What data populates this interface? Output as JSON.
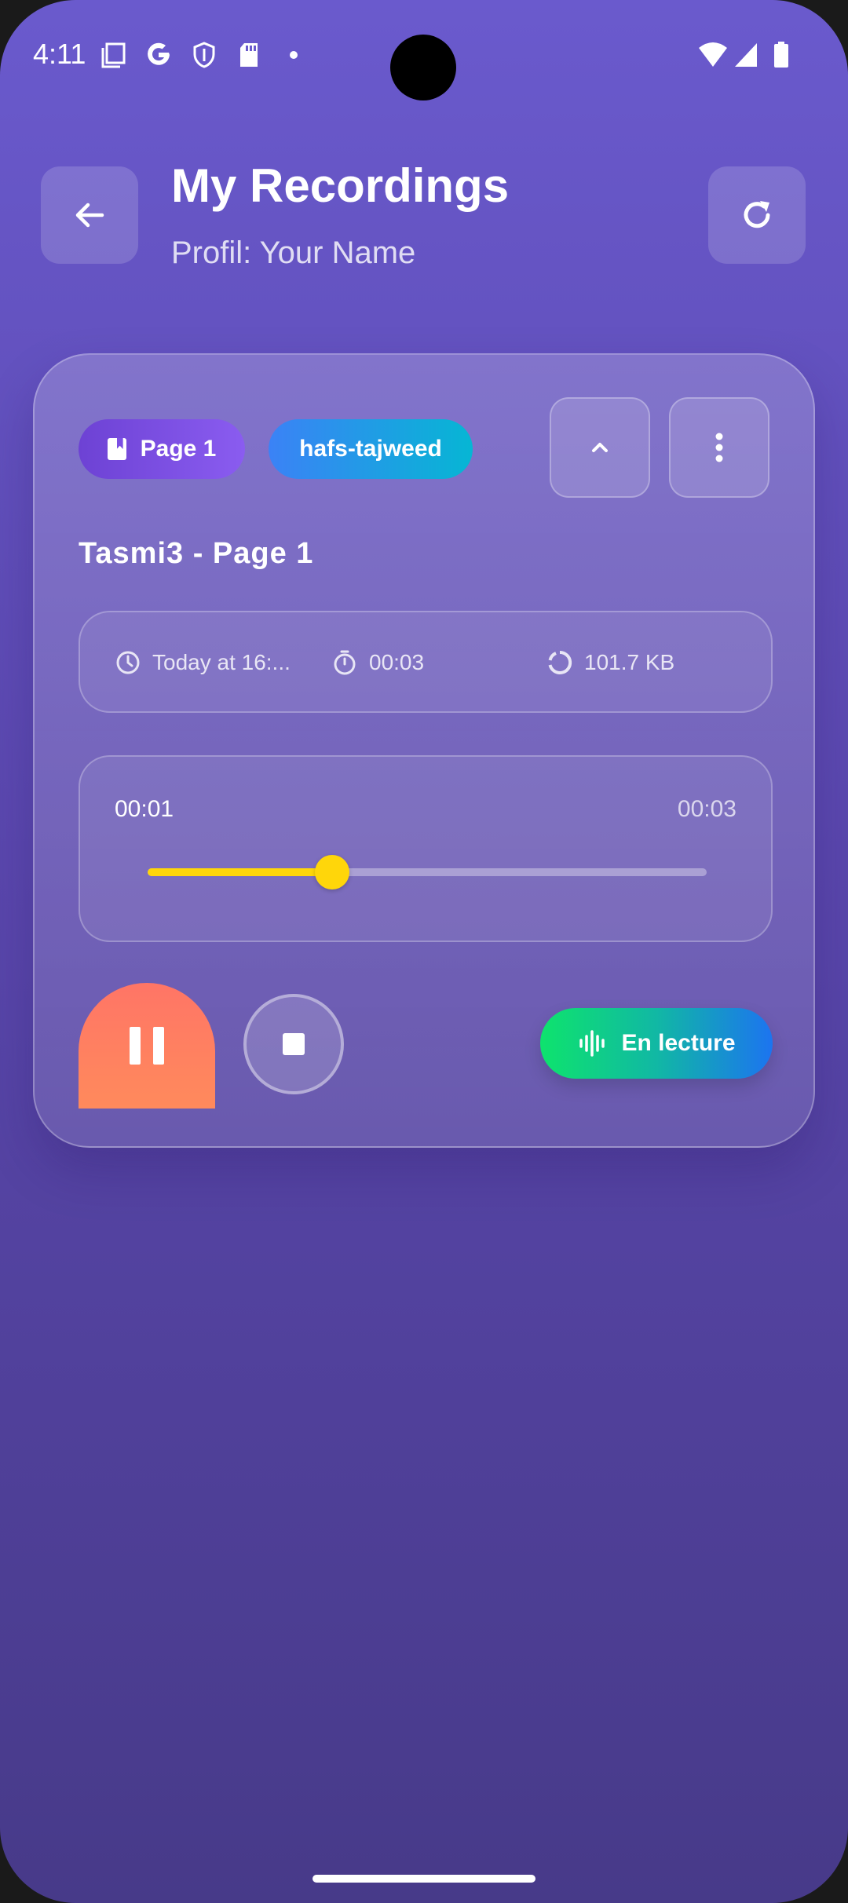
{
  "status_bar": {
    "time": "4:11",
    "left_icons": [
      "screenshot-icon",
      "google-icon",
      "shield-icon",
      "sd-card-icon",
      "dot-icon"
    ],
    "right_icons": [
      "wifi-icon",
      "signal-icon",
      "battery-icon"
    ]
  },
  "header": {
    "title": "My Recordings",
    "subtitle": "Profil: Your Name",
    "back_icon": "arrow-left-icon",
    "refresh_icon": "refresh-icon"
  },
  "recording": {
    "page_tag": "Page 1",
    "riwaya_tag": "hafs-tajweed",
    "title": "Tasmi3 - Page 1",
    "date": "Today at 16:...",
    "duration": "00:03",
    "size": "101.7 KB",
    "player": {
      "current_time": "00:01",
      "total_time": "00:03",
      "progress": 0.33
    },
    "status_label": "En lecture"
  },
  "colors": {
    "background_top": "#6a5acd",
    "background_bottom": "#473a89",
    "accent_yellow": "#ffd60a",
    "pause_button": "#ff7566",
    "status_green": "#0ee36d",
    "status_blue": "#1c74f0"
  }
}
